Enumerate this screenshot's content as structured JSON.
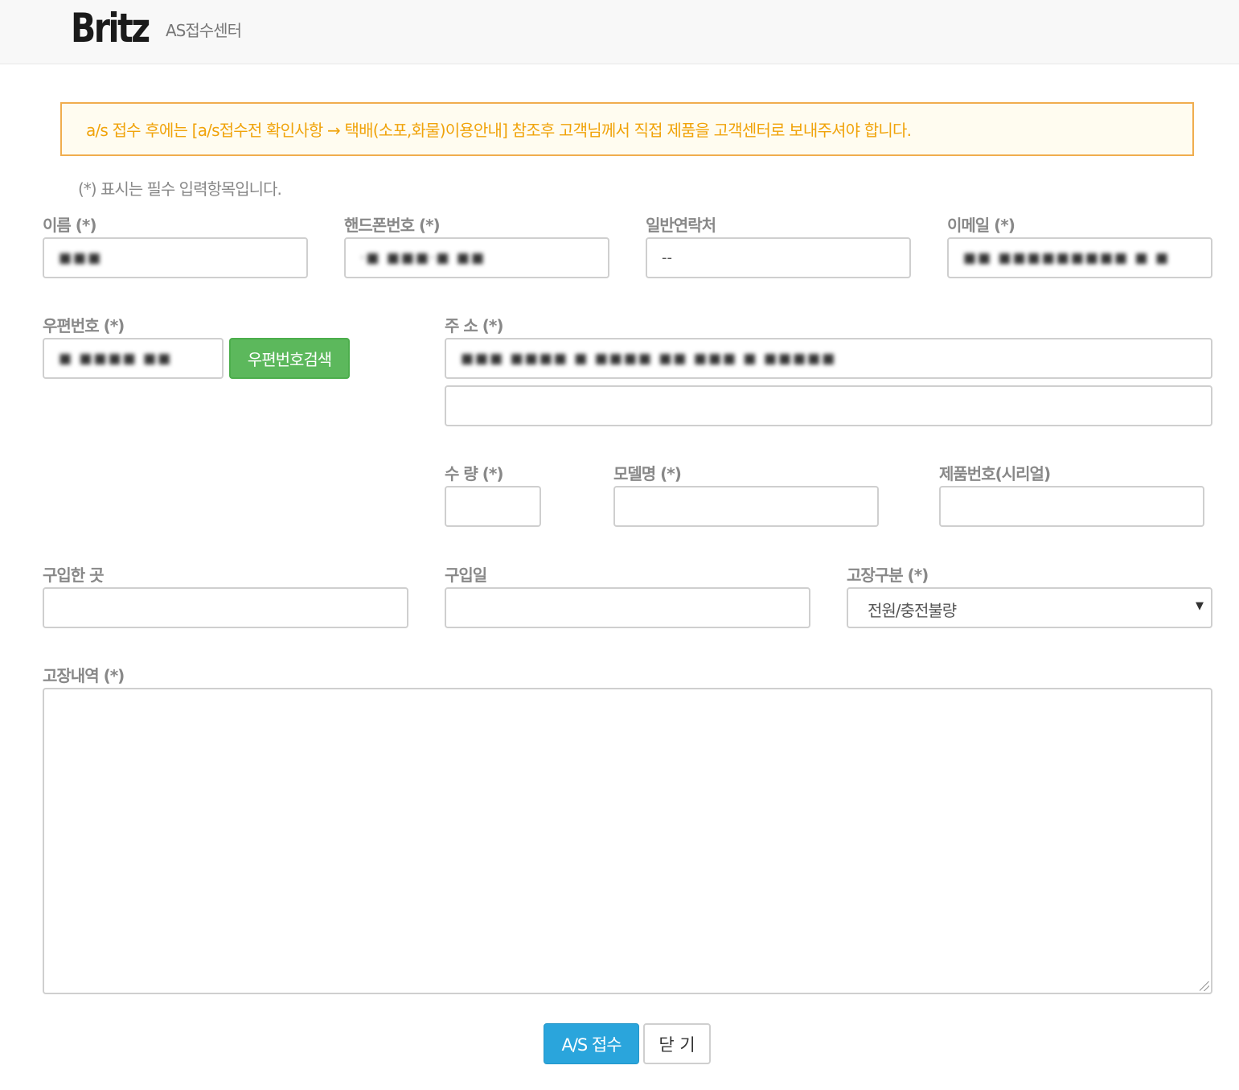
{
  "header": {
    "logo": "Britz",
    "site_title": "AS접수센터"
  },
  "notice": "a/s 접수 후에는 [a/s접수전 확인사항 → 택배(소포,화물)이용안내] 참조후 고객님께서 직접 제품을 고객센터로 보내주셔야 합니다.",
  "required_note": "(*) 표시는 필수 입력항목입니다.",
  "fields": {
    "name": {
      "label": "이름 (*)",
      "value": "[redacted]"
    },
    "mobile": {
      "label": "핸드폰번호 (*)",
      "value": "[redacted]"
    },
    "phone": {
      "label": "일반연락처",
      "value": "--"
    },
    "email": {
      "label": "이메일 (*)",
      "value": "[redacted]"
    },
    "zipcode": {
      "label": "우편번호 (*)",
      "value": "[redacted]"
    },
    "address": {
      "label": "주 소 (*)",
      "value": "[redacted]",
      "detail_value": ""
    },
    "quantity": {
      "label": "수 량 (*)",
      "value": ""
    },
    "model": {
      "label": "모델명 (*)",
      "value": ""
    },
    "serial": {
      "label": "제품번호(시리얼)",
      "value": ""
    },
    "store": {
      "label": "구입한 곳",
      "value": ""
    },
    "purchase_date": {
      "label": "구입일",
      "value": ""
    },
    "fault_type": {
      "label": "고장구분 (*)",
      "selected": "전원/충전불량"
    },
    "fault_detail": {
      "label": "고장내역 (*)",
      "value": ""
    }
  },
  "buttons": {
    "zip_search": "우편번호검색",
    "submit": "A/S 접수",
    "close": "닫 기"
  },
  "colors": {
    "notice_border": "#f0ad4e",
    "notice_text": "#f0a30a",
    "zip_button": "#5cb85c",
    "submit_button": "#2aa5dc"
  }
}
